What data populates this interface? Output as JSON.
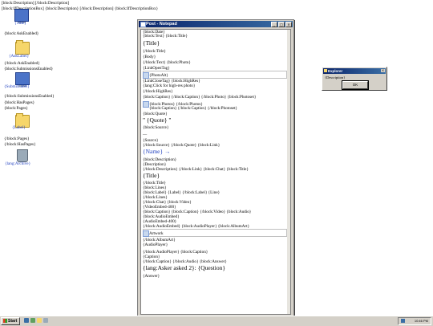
{
  "desktop": {
    "top_line1": "[block:Description] [/block:Description]",
    "top_line2": "[block:IfDescriptionBox] {block:Description} [/block:Description] {block:IfDescriptionBox}",
    "icon_title": "{Title}",
    "block_ask_enabled": "{block:AskEnabled}",
    "icon_ask_label": "{AskLabel}",
    "end_ask_enabled": "{/block:AskEnabled}",
    "block_submissions_enabled": "{block:SubmissionsEnabled}",
    "icon_submit_label": "{SubmitLabel}",
    "end_submissions_enabled": "{/block:SubmissionsEnabled}",
    "block_has_pages": "{block:HasPages}",
    "block_pages": "{block:Pages}",
    "icon_label": "{Label}",
    "end_pages": "{/block:Pages}",
    "end_has_pages": "{/block:HasPages}",
    "icon_archive": "{lang:Archive}"
  },
  "notepad": {
    "title": "Post - Notepad",
    "lines": [
      "{block:Date}",
      "{block:Text} {block:Title}",
      "{Title}",
      "{/block:Title}",
      "{Body}",
      "{/block:Text} {block:Photo}",
      "{LinkOpenTag}",
      "{PhotoAlt}",
      "{LinkCloseTag} {block:HighRes}",
      "{lang:Click for high-res photo}",
      "{/block:HighRes}",
      "{block:Caption} {/block:Caption} {/block:Photo} {block:Photoset}",
      "{block:Photos} {/block:Photos}",
      "{block:Caption} {/block:Caption} {/block:Photoset}",
      "{block:Quote}",
      "\" {Quote} \"",
      "{block:Source}",
      "—",
      "{Source}",
      "{/block:Source} {/block:Quote} {block:Link}",
      "{Name} →",
      "{block:Description}",
      "{Description}",
      "{/block:Description} {/block:Link} {block:Chat} {block:Title}",
      "{Title}",
      "{/block:Title}",
      "{block:Lines}",
      "{block:Label} {Label} {/block:Label} {Line}",
      "{/block:Lines}",
      "{/block:Chat} {block:Video}",
      "{VideoEmbed-400}",
      "{block:Caption} {block:Caption} {/block:Video} {block:Audio}",
      "{block:AudioEmbed}",
      "{AudioEmbed-400}",
      "{/block:AudioEmbed} {block:AudioPlayer} {block:AlbumArt}",
      "Artwork",
      "{/block:AlbumArt}",
      "{AudioPlayer}",
      "{/block:AudioPlayer} {block:Caption}",
      "{Caption}",
      "{/block:Caption} {/block:Audio} {block:Answer}",
      "{lang:Asker asked 2}: {Question}",
      "{Answer}"
    ]
  },
  "dialog": {
    "title": "Explorer",
    "message": "{Description}",
    "ok_label": "OK"
  },
  "taskbar": {
    "start_label": "Start",
    "clock": "10:46 PM"
  }
}
